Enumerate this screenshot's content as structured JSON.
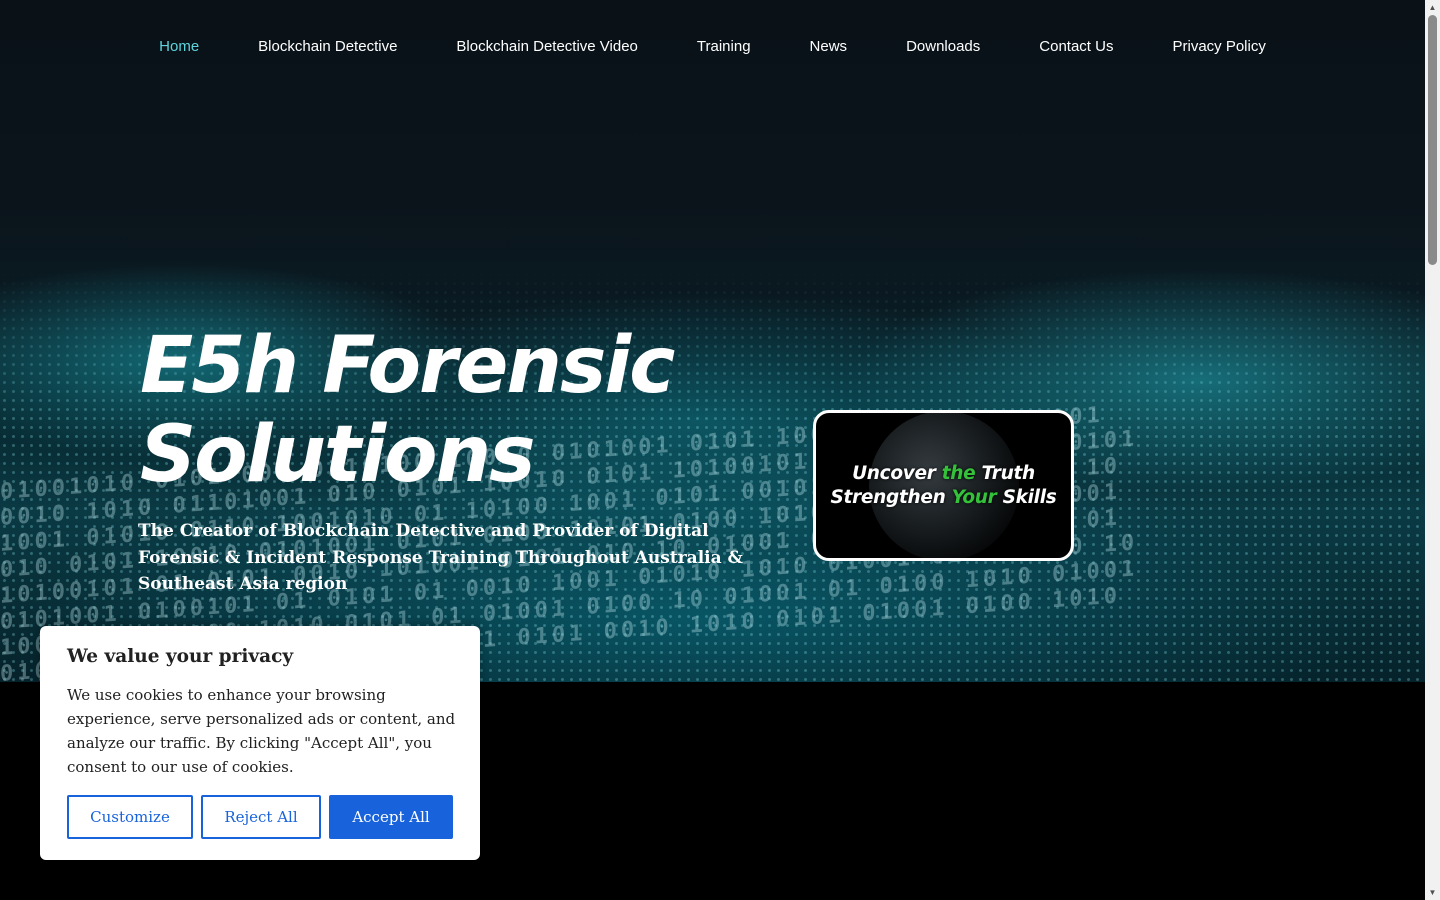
{
  "nav": {
    "items": [
      {
        "label": "Home",
        "active": true
      },
      {
        "label": "Blockchain Detective"
      },
      {
        "label": "Blockchain Detective Video"
      },
      {
        "label": "Training"
      },
      {
        "label": "News"
      },
      {
        "label": "Downloads"
      },
      {
        "label": "Contact Us"
      },
      {
        "label": "Privacy Policy"
      }
    ]
  },
  "hero": {
    "title_line1": "E5h Forensic",
    "title_line2": "Solutions",
    "subtitle": "The Creator of Blockchain Detective and Provider of Digital Forensic & Incident Response Training Throughout Australia & Southeast Asia region"
  },
  "promo": {
    "line1_a": "Uncover ",
    "line1_b": "the",
    "line1_c": " Truth",
    "line2_a": "Strengthen ",
    "line2_b": "Your",
    "line2_c": " Skills",
    "accent_color": "#34c23a"
  },
  "cookie": {
    "title": "We value your privacy",
    "text": "We use cookies to enhance your browsing experience, serve personalized ads or content, and analyze our traffic. By clicking \"Accept All\", you consent to our use of cookies.",
    "customize_label": "Customize",
    "reject_label": "Reject All",
    "accept_label": "Accept All",
    "accent_color": "#1863dc"
  },
  "colors": {
    "nav_active": "#5fd3dc"
  }
}
